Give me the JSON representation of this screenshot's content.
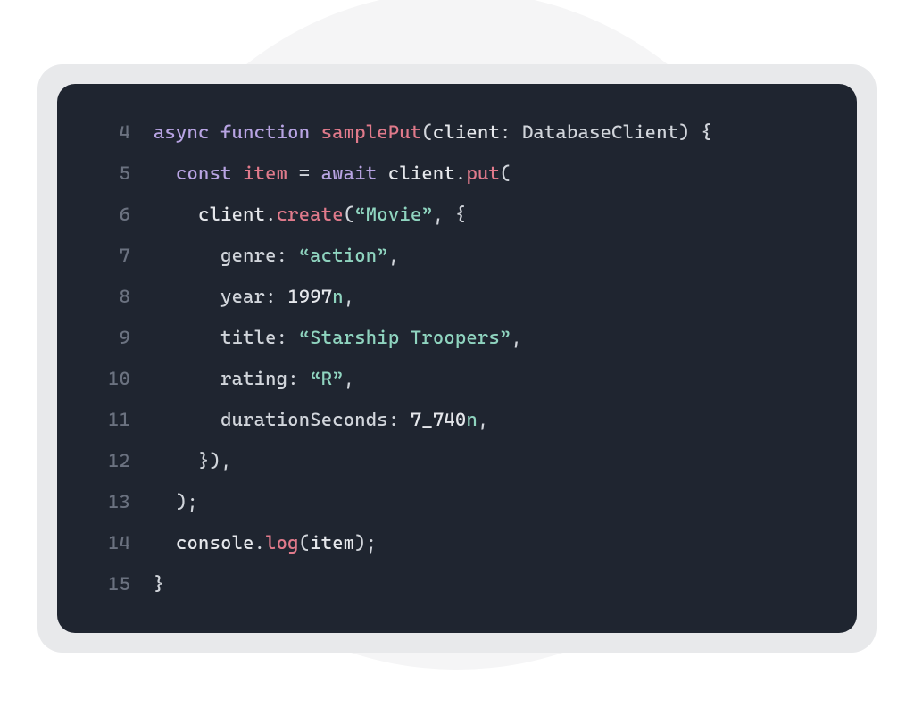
{
  "colors": {
    "background": "#ffffff",
    "outerPanel": "#e8e9eb",
    "codePanel": "#1f2530",
    "lineNumber": "#6b7280",
    "default": "#e5e7eb",
    "keyword": "#b8a4e3",
    "function": "#e07a8b",
    "string": "#8fd4bf"
  },
  "code": {
    "startLine": 4,
    "lines": [
      {
        "n": "4",
        "indent": "",
        "tokens": [
          {
            "t": "async ",
            "c": "keyword"
          },
          {
            "t": "function ",
            "c": "keyword"
          },
          {
            "t": "samplePut",
            "c": "fn"
          },
          {
            "t": "(",
            "c": "punct"
          },
          {
            "t": "client",
            "c": "ident"
          },
          {
            "t": ": ",
            "c": "punct"
          },
          {
            "t": "DatabaseClient",
            "c": "type"
          },
          {
            "t": ") {",
            "c": "punct"
          }
        ]
      },
      {
        "n": "5",
        "indent": "  ",
        "tokens": [
          {
            "t": "const ",
            "c": "keyword"
          },
          {
            "t": "item",
            "c": "var"
          },
          {
            "t": " = ",
            "c": "punct"
          },
          {
            "t": "await ",
            "c": "keyword"
          },
          {
            "t": "client",
            "c": "ident"
          },
          {
            "t": ".",
            "c": "punct"
          },
          {
            "t": "put",
            "c": "method"
          },
          {
            "t": "(",
            "c": "punct"
          }
        ]
      },
      {
        "n": "6",
        "indent": "    ",
        "tokens": [
          {
            "t": "client",
            "c": "ident"
          },
          {
            "t": ".",
            "c": "punct"
          },
          {
            "t": "create",
            "c": "method"
          },
          {
            "t": "(",
            "c": "punct"
          },
          {
            "t": "“Movie”",
            "c": "string"
          },
          {
            "t": ", {",
            "c": "punct"
          }
        ]
      },
      {
        "n": "7",
        "indent": "      ",
        "tokens": [
          {
            "t": "genre",
            "c": "prop"
          },
          {
            "t": ": ",
            "c": "punct"
          },
          {
            "t": "“action”",
            "c": "string"
          },
          {
            "t": ",",
            "c": "punct"
          }
        ]
      },
      {
        "n": "8",
        "indent": "      ",
        "tokens": [
          {
            "t": "year",
            "c": "prop"
          },
          {
            "t": ": ",
            "c": "punct"
          },
          {
            "t": "1997",
            "c": "ident"
          },
          {
            "t": "n",
            "c": "num-suffix"
          },
          {
            "t": ",",
            "c": "punct"
          }
        ]
      },
      {
        "n": "9",
        "indent": "      ",
        "tokens": [
          {
            "t": "title",
            "c": "prop"
          },
          {
            "t": ": ",
            "c": "punct"
          },
          {
            "t": "“Starship Troopers”",
            "c": "string"
          },
          {
            "t": ",",
            "c": "punct"
          }
        ]
      },
      {
        "n": "10",
        "indent": "      ",
        "tokens": [
          {
            "t": "rating",
            "c": "prop"
          },
          {
            "t": ": ",
            "c": "punct"
          },
          {
            "t": "“R”",
            "c": "string"
          },
          {
            "t": ",",
            "c": "punct"
          }
        ]
      },
      {
        "n": "11",
        "indent": "      ",
        "tokens": [
          {
            "t": "durationSeconds",
            "c": "prop"
          },
          {
            "t": ": ",
            "c": "punct"
          },
          {
            "t": "7_740",
            "c": "ident"
          },
          {
            "t": "n",
            "c": "num-suffix"
          },
          {
            "t": ",",
            "c": "punct"
          }
        ]
      },
      {
        "n": "12",
        "indent": "    ",
        "tokens": [
          {
            "t": "}),",
            "c": "punct"
          }
        ]
      },
      {
        "n": "13",
        "indent": "  ",
        "tokens": [
          {
            "t": ");",
            "c": "punct"
          }
        ]
      },
      {
        "n": "14",
        "indent": "  ",
        "tokens": [
          {
            "t": "console",
            "c": "ident"
          },
          {
            "t": ".",
            "c": "punct"
          },
          {
            "t": "log",
            "c": "method"
          },
          {
            "t": "(",
            "c": "punct"
          },
          {
            "t": "item",
            "c": "ident"
          },
          {
            "t": ");",
            "c": "punct"
          }
        ]
      },
      {
        "n": "15",
        "indent": "",
        "tokens": [
          {
            "t": "}",
            "c": "punct"
          }
        ]
      }
    ]
  }
}
